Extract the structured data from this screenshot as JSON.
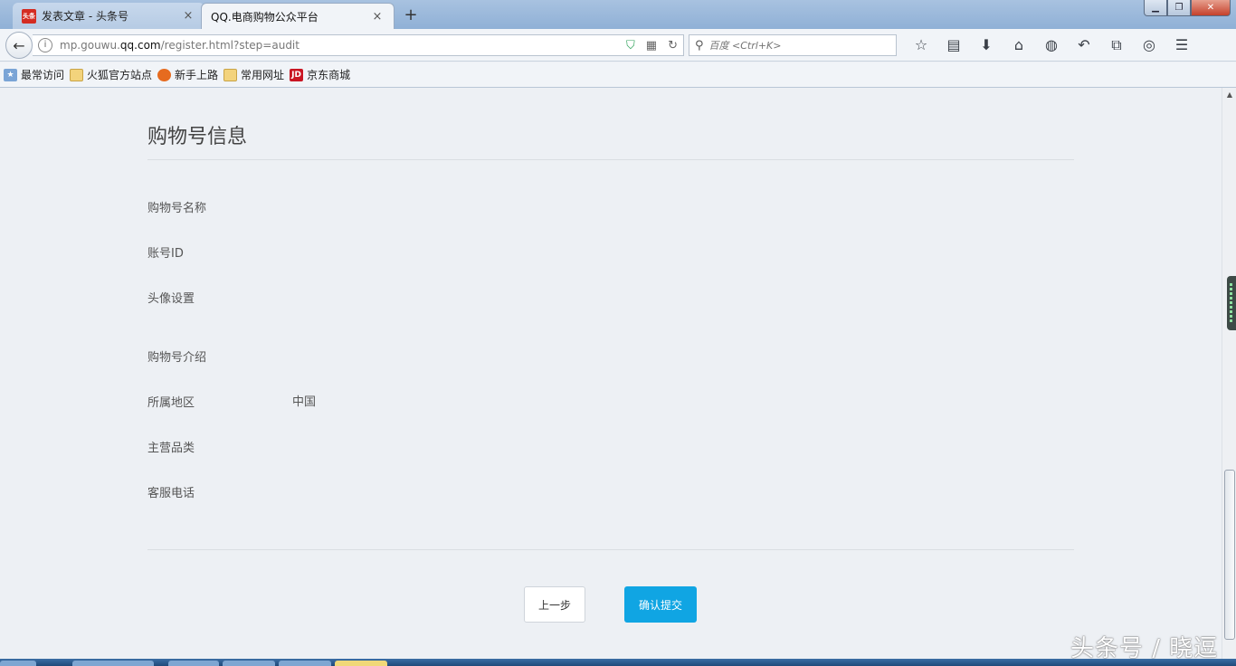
{
  "browser": {
    "tabs": [
      {
        "title": "发表文章 - 头条号",
        "favicon": "头条",
        "active": false
      },
      {
        "title": "QQ.电商购物公众平台",
        "active": true
      }
    ],
    "newtab_glyph": "+",
    "close_glyph": "×",
    "url_prefix": "mp.gouwu.",
    "url_domain": "qq.com",
    "url_suffix": "/register.html?step=audit",
    "search_placeholder": "百度 <Ctrl+K>",
    "bookmarks": [
      {
        "label": "最常访问",
        "icon": "bookmark-star-icon"
      },
      {
        "label": "火狐官方站点",
        "icon": "folder-icon"
      },
      {
        "label": "新手上路",
        "icon": "firefox-icon"
      },
      {
        "label": "常用网址",
        "icon": "folder-icon"
      },
      {
        "label": "京东商城",
        "icon": "jd-icon",
        "badge": "JD"
      }
    ]
  },
  "page": {
    "section_title": "购物号信息",
    "fields": [
      {
        "label": "购物号名称",
        "value": ""
      },
      {
        "label": "账号ID",
        "value": ""
      },
      {
        "label": "头像设置",
        "value": ""
      },
      {
        "label": "购物号介绍",
        "value": ""
      },
      {
        "label": "所属地区",
        "value": "中国"
      },
      {
        "label": "主营品类",
        "value": ""
      },
      {
        "label": "客服电话",
        "value": ""
      }
    ],
    "prev_button": "上一步",
    "submit_button": "确认提交"
  },
  "watermark": "头条号 / 晓逗",
  "colors": {
    "accent": "#10a5e3",
    "background": "#edf0f4"
  }
}
